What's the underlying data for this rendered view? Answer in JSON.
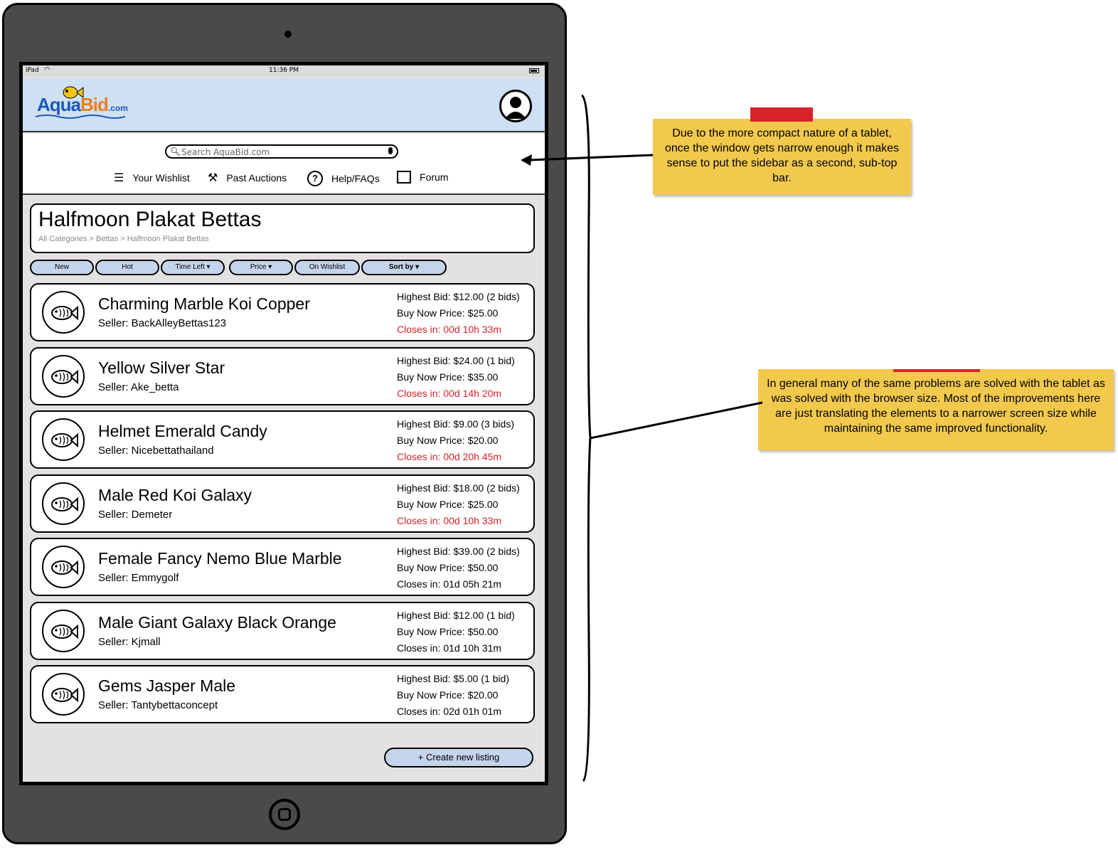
{
  "device": {
    "status_left": "iPad",
    "time": "11:36 PM"
  },
  "logo": {
    "aqua": "Aqua",
    "bid": "Bid",
    "com": ".com"
  },
  "search": {
    "placeholder": "Search AquaBid.com"
  },
  "nav": [
    {
      "label": "Your Wishlist",
      "icon": "list-icon"
    },
    {
      "label": "Past Auctions",
      "icon": "gavel-icon"
    },
    {
      "label": "Help/FAQs",
      "icon": "help-icon"
    },
    {
      "label": "Forum",
      "icon": "forum-icon"
    }
  ],
  "page": {
    "title": "Halfmoon Plakat Bettas",
    "breadcrumb": "All Categories > Bettas > Halfmoon Plakat Bettas"
  },
  "filters": [
    "New",
    "Hot",
    "Time Left ▾",
    "Price ▾",
    "On Wishlist",
    "Sort by ▾"
  ],
  "listings": [
    {
      "name": "Charming Marble Koi Copper",
      "seller": "Seller: BackAlleyBettas123",
      "highest_bid": "Highest Bid: $12.00 (2 bids)",
      "buy_now": "Buy Now Price: $25.00",
      "closes": "Closes in: 00d 10h 33m",
      "urgent": true
    },
    {
      "name": "Yellow Silver Star",
      "seller": "Seller: Ake_betta",
      "highest_bid": "Highest Bid: $24.00 (1 bid)",
      "buy_now": "Buy Now Price: $35.00",
      "closes": "Closes in: 00d 14h 20m",
      "urgent": true
    },
    {
      "name": "Helmet Emerald Candy",
      "seller": "Seller: Nicebettathailand",
      "highest_bid": "Highest Bid: $9.00 (3 bids)",
      "buy_now": "Buy Now Price: $20.00",
      "closes": "Closes in: 00d 20h 45m",
      "urgent": true
    },
    {
      "name": "Male Red Koi Galaxy",
      "seller": "Seller: Demeter",
      "highest_bid": "Highest Bid: $18.00 (2 bids)",
      "buy_now": "Buy Now Price: $25.00",
      "closes": "Closes in: 00d 10h 33m",
      "urgent": true
    },
    {
      "name": "Female Fancy Nemo Blue Marble",
      "seller": "Seller: Emmygolf",
      "highest_bid": "Highest Bid: $39.00 (2 bids)",
      "buy_now": "Buy Now Price: $50.00",
      "closes": "Closes in: 01d 05h 21m",
      "urgent": false
    },
    {
      "name": "Male Giant Galaxy Black Orange",
      "seller": "Seller: Kjmall",
      "highest_bid": "Highest Bid: $12.00 (1 bid)",
      "buy_now": "Buy Now Price: $50.00",
      "closes": "Closes in: 01d 10h 31m",
      "urgent": false
    },
    {
      "name": "Gems Jasper Male",
      "seller": "Seller: Tantybettaconcept",
      "highest_bid": "Highest Bid: $5.00 (1 bid)",
      "buy_now": "Buy Now Price: $20.00",
      "closes": "Closes in: 02d 01h 01m",
      "urgent": false
    }
  ],
  "create_button": "+ Create new listing",
  "notes": {
    "note1": "Due to the more compact nature of a tablet, once the window gets narrow enough it makes sense to put the sidebar as a second, sub-top bar.",
    "note2": "In general many of the same problems are solved with the tablet as was solved with the browser size. Most of the improvements here are just translating the elements to a narrower screen size while maintaining the same improved functionality."
  },
  "colors": {
    "header_bg": "#cfe0f5",
    "chip_bg": "#c4d4ec",
    "urgent_red": "#d9222a",
    "note_yellow": "#f2c94c"
  }
}
